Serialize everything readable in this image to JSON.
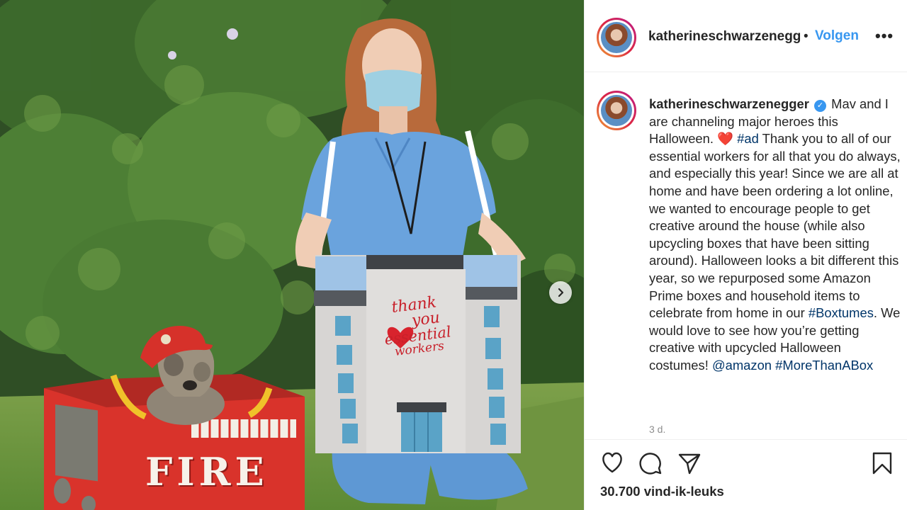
{
  "header": {
    "username": "katherineschwarzenegg",
    "separator": "•",
    "follow_label": "Volgen",
    "more_icon": "more-options-icon"
  },
  "caption": {
    "username": "katherineschwarzenegger",
    "verified_icon": "verified-badge-icon",
    "text_1": "Mav and I are channeling major heroes this Halloween.",
    "emoji": "❤️",
    "hashtag_ad": "#ad",
    "text_2": "Thank you to all of our essential workers for all that you do always, and especially this year! Since we are all at home and have been ordering a lot online, we wanted to encourage people to get creative around the house (while also upcycling boxes that have been sitting around). Halloween looks a bit different this year, so we repurposed some Amazon Prime boxes and household items to celebrate from home in our",
    "hashtag_boxtumes": "#Boxtumes",
    "text_3": ". We would love to see how you’re getting creative with upcycled Halloween costumes!",
    "mention": "@amazon",
    "hashtag_more": "#MoreThanABox"
  },
  "time_ago": "3 d.",
  "likes": "30.700 vind-ik-leuks",
  "photo": {
    "sign_line1": "thank",
    "sign_line2": "you",
    "sign_line3": "essential",
    "sign_line4": "workers",
    "truck_label": "FIRE"
  },
  "icons": {
    "like": "heart-icon",
    "comment": "comment-icon",
    "share": "share-icon",
    "save": "bookmark-icon",
    "next": "chevron-right-icon"
  },
  "colors": {
    "follow_blue": "#3897f0",
    "hashtag_navy": "#003569",
    "muted": "#8e8e8e"
  }
}
